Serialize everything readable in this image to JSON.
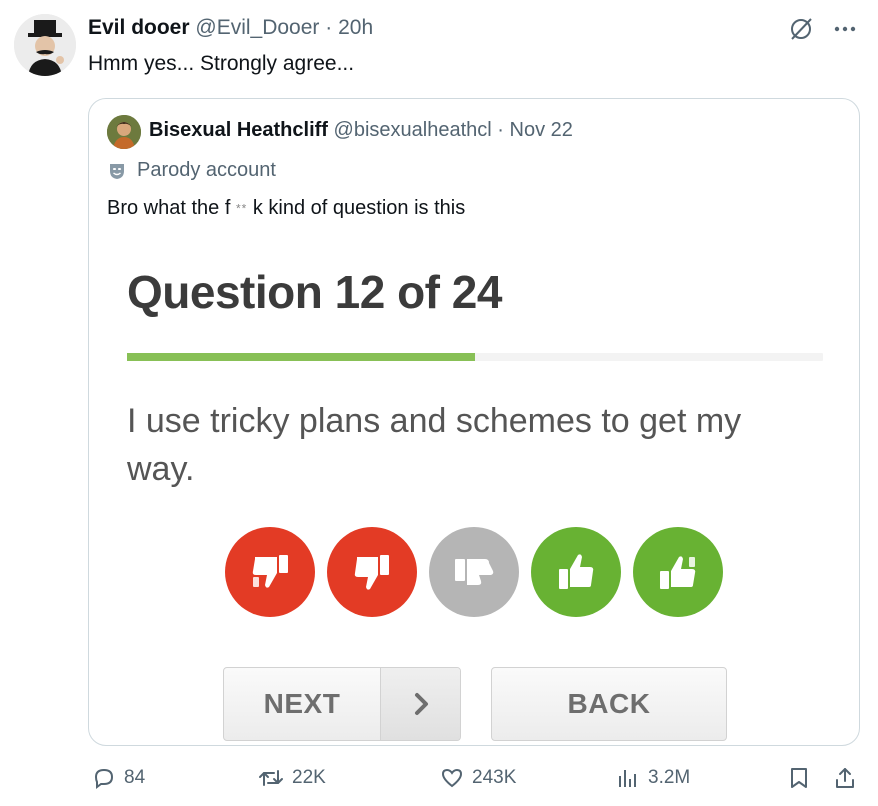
{
  "tweet": {
    "author_name": "Evil dooer",
    "author_handle": "@Evil_Dooer",
    "separator": "·",
    "time": "20h",
    "text": "Hmm yes... Strongly agree..."
  },
  "quoted_tweet": {
    "author_name": "Bisexual Heathcliff",
    "author_handle": "@bisexualheathcl",
    "separator": "·",
    "date": "Nov 22",
    "parody_label": "Parody account",
    "text_before": "Bro what the f",
    "text_redacted": "**",
    "text_after": "k kind of question is this"
  },
  "quiz": {
    "title": "Question 12 of 24",
    "progress_fraction": 0.5,
    "progress_color": "#88c056",
    "question": "I use tricky plans and schemes to get my way.",
    "answers": [
      {
        "name": "strongly-disagree",
        "icon": "thumbs-down-double-icon",
        "color": "#e33b25"
      },
      {
        "name": "disagree",
        "icon": "thumbs-down-icon",
        "color": "#e33b25"
      },
      {
        "name": "neutral",
        "icon": "thumb-sideways-icon",
        "color": "#b5b5b5"
      },
      {
        "name": "agree",
        "icon": "thumbs-up-icon",
        "color": "#68b233"
      },
      {
        "name": "strongly-agree",
        "icon": "thumbs-up-double-icon",
        "color": "#68b233"
      }
    ],
    "next_label": "NEXT",
    "back_label": "BACK"
  },
  "actions": {
    "replies": "84",
    "reposts": "22K",
    "likes": "243K",
    "views": "3.2M"
  }
}
